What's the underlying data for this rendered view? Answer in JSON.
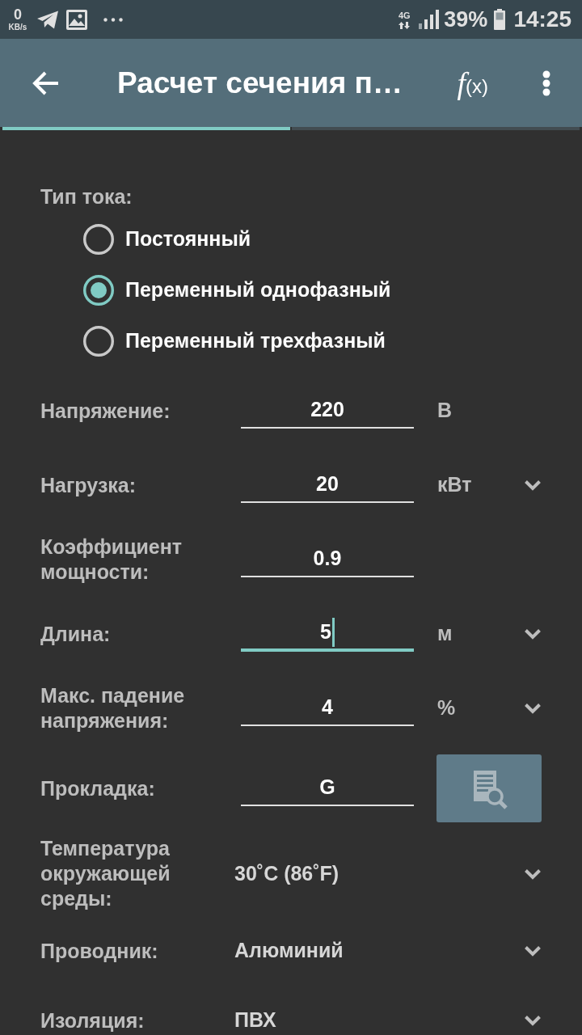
{
  "status_bar": {
    "net_speed": "0",
    "net_speed_unit": "KB/s",
    "network_type": "4G",
    "battery": "39%",
    "time": "14:25"
  },
  "app_bar": {
    "title": "Расчет сечения п…",
    "formula_button": {
      "symbol": "f",
      "argument": "(x)"
    }
  },
  "tabs": [
    {
      "selected": true
    },
    {
      "selected": false
    }
  ],
  "current_type": {
    "label": "Тип тока:",
    "options": [
      {
        "label": "Постоянный",
        "selected": false
      },
      {
        "label": "Переменный однофазный",
        "selected": true
      },
      {
        "label": "Переменный трехфазный",
        "selected": false
      }
    ]
  },
  "fields": [
    {
      "kind": "input",
      "label": "Напряжение:",
      "value": "220",
      "focused": false,
      "unit": "В",
      "unit_dropdown": false
    },
    {
      "kind": "input",
      "label": "Нагрузка:",
      "value": "20",
      "focused": false,
      "unit": "кВт",
      "unit_dropdown": true
    },
    {
      "kind": "input",
      "label": "Коэффициент мощности:",
      "value": "0.9",
      "focused": false
    },
    {
      "kind": "input",
      "label": "Длина:",
      "value": "5",
      "focused": true,
      "unit": "м",
      "unit_dropdown": true
    },
    {
      "kind": "input",
      "label": "Макс. падение напряжения:",
      "value": "4",
      "focused": false,
      "unit": "%",
      "unit_dropdown": true
    },
    {
      "kind": "lookup",
      "label": "Прокладка:",
      "value": "G",
      "focused": false
    },
    {
      "kind": "select",
      "label": "Температура окружающей среды:",
      "value": "30˚C (86˚F)"
    },
    {
      "kind": "select",
      "label": "Проводник:",
      "value": "Алюминий"
    },
    {
      "kind": "select",
      "label": "Изоляция:",
      "value": "ПВХ"
    }
  ]
}
